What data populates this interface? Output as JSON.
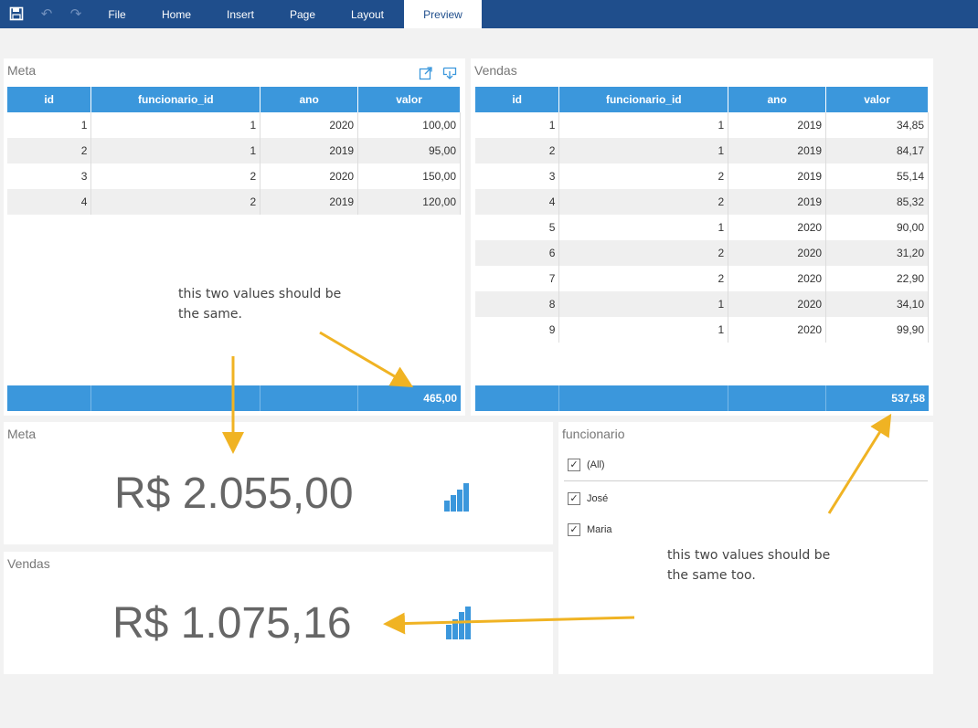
{
  "toolbar": {
    "icons": [
      "save-icon",
      "undo-icon",
      "redo-icon"
    ],
    "menu": [
      "File",
      "Home",
      "Insert",
      "Page",
      "Layout",
      "Preview"
    ],
    "active": "Preview"
  },
  "meta_grid": {
    "title": "Meta",
    "columns": [
      "id",
      "funcionario_id",
      "ano",
      "valor"
    ],
    "rows": [
      [
        "1",
        "1",
        "2020",
        "100,00"
      ],
      [
        "2",
        "1",
        "2019",
        "95,00"
      ],
      [
        "3",
        "2",
        "2020",
        "150,00"
      ],
      [
        "4",
        "2",
        "2019",
        "120,00"
      ]
    ],
    "total": "465,00"
  },
  "vendas_grid": {
    "title": "Vendas",
    "columns": [
      "id",
      "funcionario_id",
      "ano",
      "valor"
    ],
    "rows": [
      [
        "1",
        "1",
        "2019",
        "34,85"
      ],
      [
        "2",
        "1",
        "2019",
        "84,17"
      ],
      [
        "3",
        "2",
        "2019",
        "55,14"
      ],
      [
        "4",
        "2",
        "2019",
        "85,32"
      ],
      [
        "5",
        "1",
        "2020",
        "90,00"
      ],
      [
        "6",
        "2",
        "2020",
        "31,20"
      ],
      [
        "7",
        "2",
        "2020",
        "22,90"
      ],
      [
        "8",
        "1",
        "2020",
        "34,10"
      ],
      [
        "9",
        "1",
        "2020",
        "99,90"
      ]
    ],
    "total": "537,58"
  },
  "meta_card": {
    "title": "Meta",
    "value": "R$ 2.055,00"
  },
  "vendas_card": {
    "title": "Vendas",
    "value": "R$ 1.075,16"
  },
  "filter": {
    "title": "funcionario",
    "all_label": "(All)",
    "items": [
      "José",
      "Maria"
    ]
  },
  "annotations": {
    "note1_line1": "this two values should be",
    "note1_line2": "the same.",
    "note2_line1": "this two values should be",
    "note2_line2": "the same too.",
    "arrow_color": "#f0b323"
  },
  "colors": {
    "accent": "#3b97dc",
    "topbar": "#1f4e8c"
  }
}
